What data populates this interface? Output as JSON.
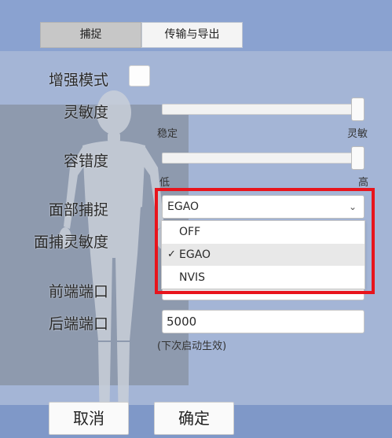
{
  "tabs": [
    {
      "label": "捕捉"
    },
    {
      "label": "传输与导出"
    }
  ],
  "settings": {
    "enhanced_mode": {
      "label": "增强模式",
      "checked": false
    },
    "sensitivity": {
      "label": "灵敏度",
      "min_label": "稳定",
      "max_label": "灵敏",
      "value": 1.0
    },
    "tolerance": {
      "label": "容错度",
      "min_label": "低",
      "max_label": "高",
      "value": 1.0
    },
    "face_capture": {
      "label": "面部捕捉",
      "selected": "EGAO",
      "options": [
        "OFF",
        "EGAO",
        "NVIS"
      ]
    },
    "face_sensitivity": {
      "label": "面捕灵敏度"
    },
    "front_port": {
      "label": "前端端口"
    },
    "back_port": {
      "label": "后端端口",
      "value": "5000",
      "hint": "(下次启动生效)"
    }
  },
  "buttons": {
    "cancel": "取消",
    "ok": "确定"
  },
  "colors": {
    "highlight": "#e8141c",
    "panel": "#a4b5d6",
    "background": "#7f98c8"
  }
}
